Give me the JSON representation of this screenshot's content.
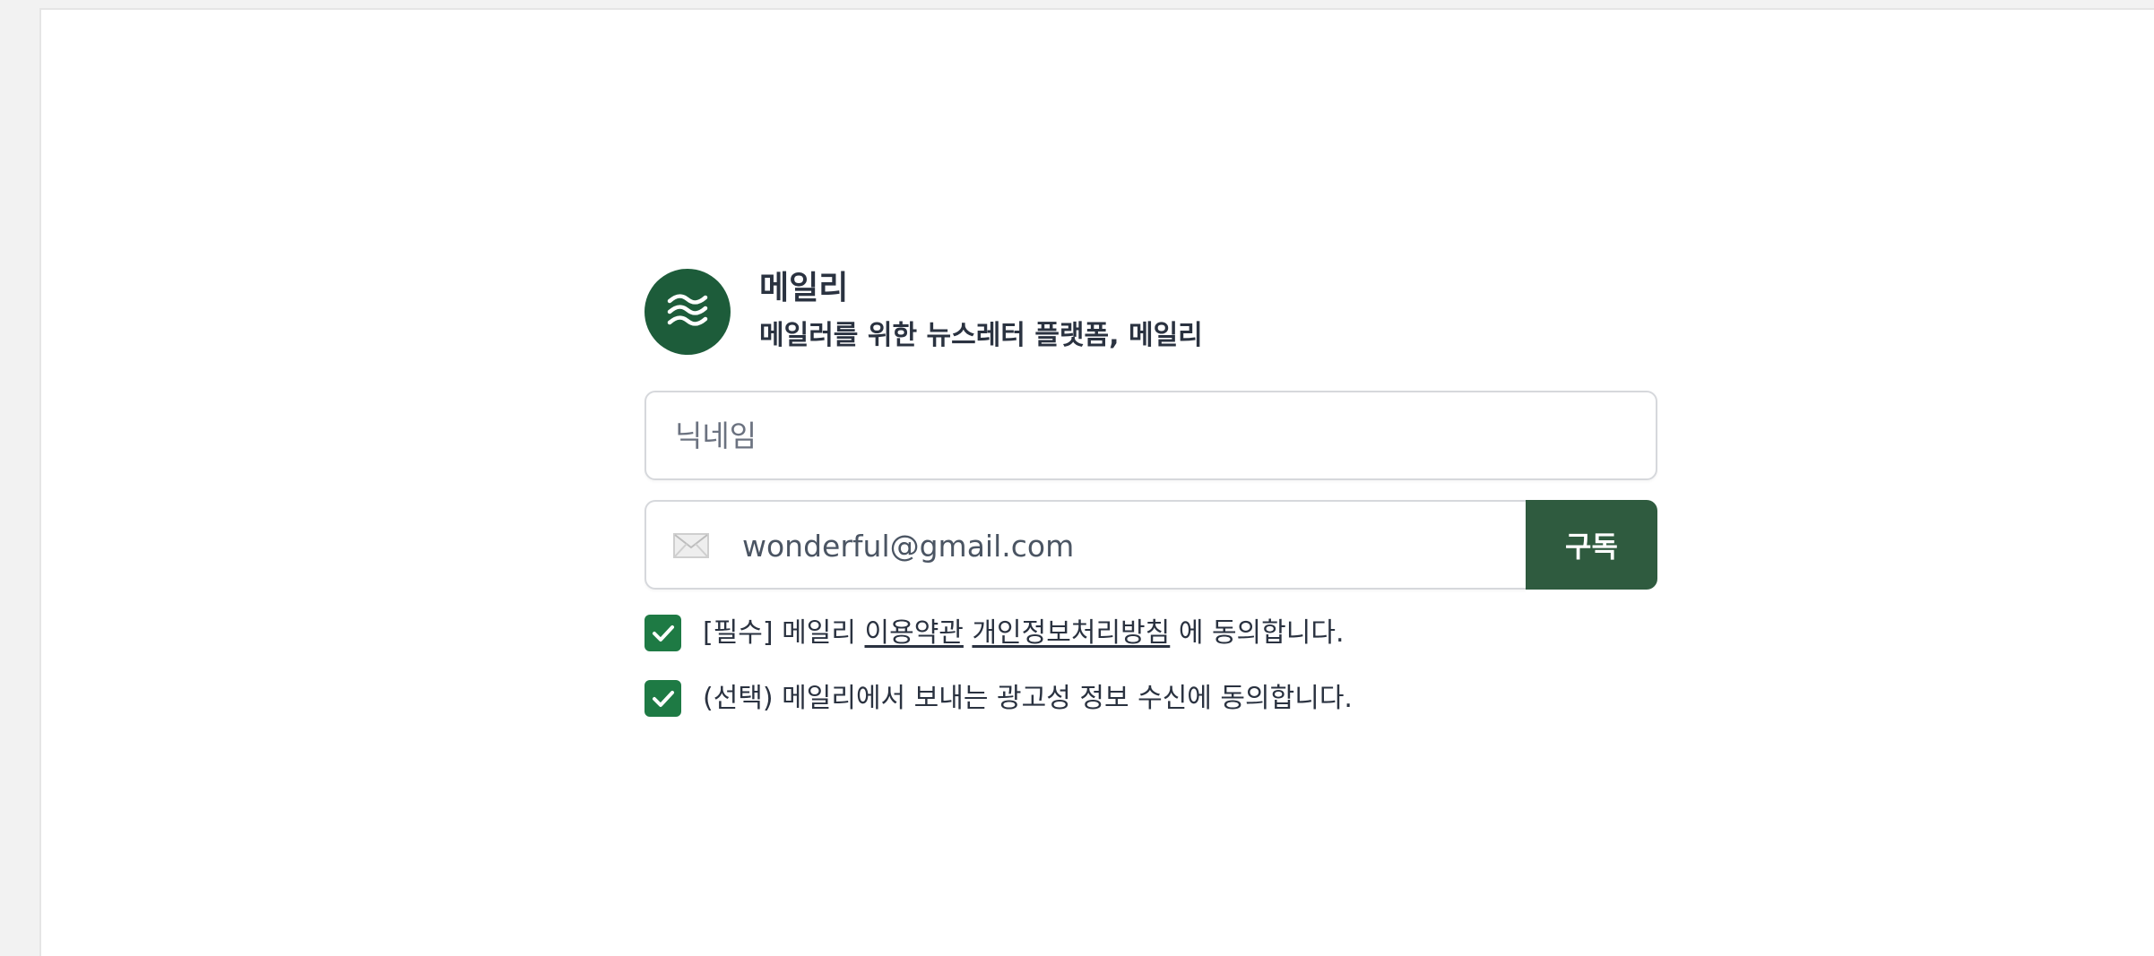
{
  "brand": {
    "icon": "wave-logo-icon",
    "title": "메일리",
    "subtitle": "메일러를 위한 뉴스레터 플랫폼, 메일리"
  },
  "form": {
    "nickname_placeholder": "닉네임",
    "email_placeholder": "wonderful@gmail.com",
    "email_icon": "mail-icon",
    "subscribe_label": "구독"
  },
  "agreements": {
    "required": {
      "checked": true,
      "prefix": "[필수] 메일리",
      "terms_link": "이용약관",
      "privacy_link": "개인정보처리방침",
      "suffix": "에 동의합니다."
    },
    "optional": {
      "checked": true,
      "text": "(선택) 메일리에서 보내는 광고성 정보 수신에 동의합니다."
    }
  },
  "colors": {
    "brand_green": "#1d5c3a",
    "button_green": "#2f5b3f",
    "checkbox_green": "#1e7a44",
    "text": "#2a3240"
  }
}
